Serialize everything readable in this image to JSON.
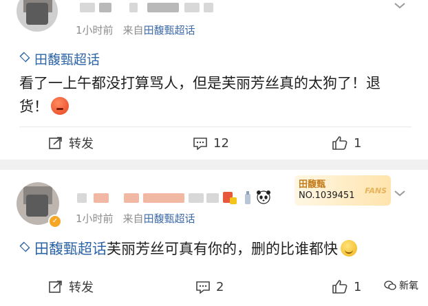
{
  "colors": {
    "link": "#2c64a6",
    "meta": "#8c8c8c",
    "badge_gold": "#c37a18"
  },
  "posts": [
    {
      "meta": {
        "time": "1小时前",
        "from_prefix": "来自",
        "source": "田馥甄超话"
      },
      "topic": "田馥甄超话",
      "text": "看了一上午都没打算骂人，但是芙丽芳丝真的太狗了！退货！",
      "emoji": "angry-face-emoji",
      "actions": {
        "repost_label": "转发",
        "comment_count": "12",
        "like_count": "1"
      }
    },
    {
      "meta": {
        "time": "1小时前",
        "from_prefix": "来自",
        "source": "田馥甄超话"
      },
      "topic": "田馥甄超话",
      "text": "芙丽芳丝可真有你的，删的比谁都快",
      "emoji": "smile-emoji",
      "fans_badge": {
        "name": "田馥甄",
        "number": "NO.1039451",
        "word": "FANS"
      },
      "actions": {
        "repost_label": "转发",
        "comment_count": "2",
        "like_count": "1"
      }
    }
  ],
  "watermark": {
    "text": "新氧",
    "icon": "wechat-icon"
  }
}
